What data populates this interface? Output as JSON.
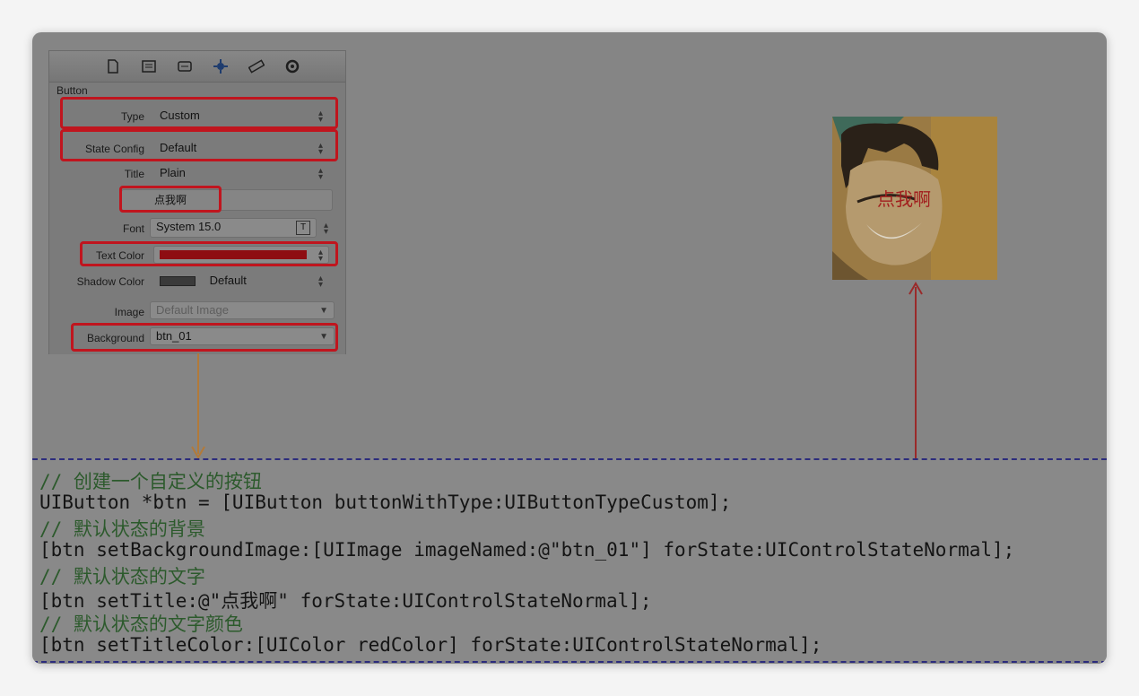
{
  "inspector": {
    "section_title": "Button",
    "toolbar_icons": [
      "document-icon",
      "identity-icon",
      "attributes-icon",
      "connections-icon",
      "size-ruler-icon",
      "settings-circle-icon"
    ],
    "rows": {
      "type": {
        "label": "Type",
        "value": "Custom"
      },
      "state_config": {
        "label": "State Config",
        "value": "Default"
      },
      "title": {
        "label": "Title",
        "value": "Plain"
      },
      "title_text": {
        "value": "点我啊"
      },
      "font": {
        "label": "Font",
        "value": "System 15.0"
      },
      "text_color": {
        "label": "Text Color",
        "color": "#8e0d12"
      },
      "shadow_color": {
        "label": "Shadow Color",
        "value": "Default",
        "color": "#3a3a3a"
      },
      "image": {
        "label": "Image",
        "placeholder": "Default Image"
      },
      "background": {
        "label": "Background",
        "value": "btn_01"
      }
    }
  },
  "preview": {
    "label": "点我啊"
  },
  "code": {
    "lines": [
      {
        "text": "// 创建一个自定义的按钮",
        "kind": "comment"
      },
      {
        "text": "UIButton *btn = [UIButton buttonWithType:UIButtonTypeCustom];",
        "kind": "code"
      },
      {
        "text": "// 默认状态的背景",
        "kind": "comment"
      },
      {
        "text": "[btn setBackgroundImage:[UIImage imageNamed:@\"btn_01\"] forState:UIControlStateNormal];",
        "kind": "code"
      },
      {
        "text": "// 默认状态的文字",
        "kind": "comment"
      },
      {
        "text": "[btn setTitle:@\"点我啊\" forState:UIControlStateNormal];",
        "kind": "code"
      },
      {
        "text": "// 默认状态的文字颜色",
        "kind": "comment"
      },
      {
        "text": "[btn setTitleColor:[UIColor redColor] forState:UIControlStateNormal];",
        "kind": "code"
      }
    ]
  },
  "colors": {
    "highlight": "#c0151e",
    "arrow_orange": "#b27a3a",
    "arrow_red": "#9a2a2a",
    "divider": "#2c2c7c"
  }
}
